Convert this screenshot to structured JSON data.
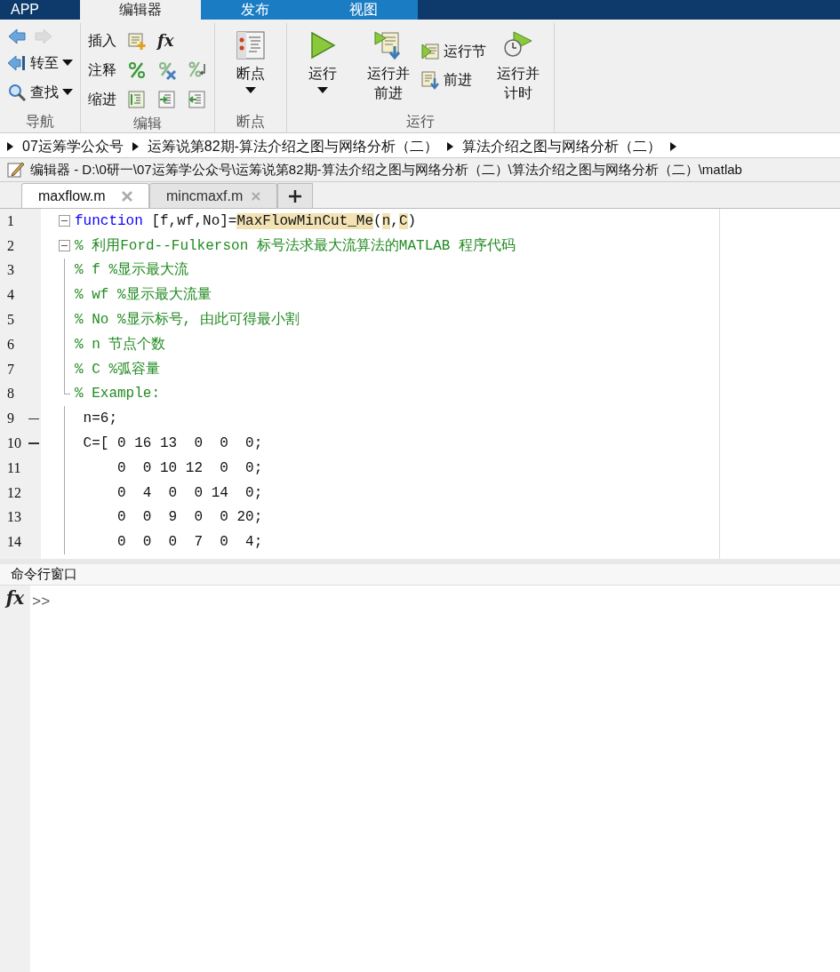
{
  "ribbon_tabs": [
    {
      "label": "APP",
      "selected": false
    },
    {
      "label": "编辑器",
      "selected": true
    },
    {
      "label": "发布",
      "selected": false
    },
    {
      "label": "视图",
      "selected": false
    }
  ],
  "ribbon_groups": [
    {
      "title": "导航",
      "kind": "nav",
      "items": [
        {
          "disabled": false
        },
        {
          "disabled": true
        },
        {
          "label": "转至"
        },
        {
          "label": "查找"
        }
      ]
    },
    {
      "title": "编辑",
      "kind": "edit",
      "items": [
        {
          "label": "插入",
          "function_button": "fx"
        },
        {
          "label": "注释"
        },
        {
          "label": "缩进"
        }
      ]
    },
    {
      "title": "断点",
      "kind": "big",
      "items": [
        {
          "label": "断点",
          "dropdown": true
        }
      ]
    },
    {
      "title": "运行",
      "kind": "run",
      "items": [
        {
          "label": "运行",
          "dropdown": true,
          "kind": "large"
        },
        {
          "label": "运行并前进",
          "dropdown": false,
          "kind": "large"
        },
        {
          "label": "运行节",
          "kind": "small"
        },
        {
          "label": "前进",
          "kind": "small"
        },
        {
          "label": "运行并计时",
          "dropdown": false,
          "kind": "large"
        }
      ]
    }
  ],
  "breadcrumb": [
    "07运筹学公众号",
    "运筹说第82期-算法介绍之图与网络分析（二）",
    "算法介绍之图与网络分析（二）"
  ],
  "editor_title": "编辑器 - D:\\0研一\\07运筹学公众号\\运筹说第82期-算法介绍之图与网络分析（二）\\算法介绍之图与网络分析（二）\\matlab",
  "file_tabs": [
    {
      "label": "maxflow.m",
      "selected": true
    },
    {
      "label": "mincmaxf.m",
      "selected": false
    }
  ],
  "code_lines": [
    {
      "number": "1",
      "fold_start": true,
      "fold_end": false,
      "executable": false,
      "segments": [
        {
          "text": "function",
          "kind": "keyword",
          "highlighted": false
        },
        {
          "text": " [f,wf,No]=",
          "kind": "plain",
          "highlighted": false
        },
        {
          "text": "MaxFlowMinCut_Me",
          "kind": "plain",
          "highlighted": true
        },
        {
          "text": "(",
          "kind": "plain",
          "highlighted": false
        },
        {
          "text": "n",
          "kind": "plain",
          "highlighted": true
        },
        {
          "text": ",",
          "kind": "plain",
          "highlighted": false
        },
        {
          "text": "C",
          "kind": "plain",
          "highlighted": true
        },
        {
          "text": ")",
          "kind": "plain",
          "highlighted": false
        }
      ]
    },
    {
      "number": "2",
      "fold_start": true,
      "fold_end": false,
      "executable": false,
      "segments": [
        {
          "text": "% 利用Ford--Fulkerson 标号法求最大流算法的MATLAB 程序代码",
          "kind": "comment",
          "highlighted": false
        }
      ]
    },
    {
      "number": "3",
      "fold_start": false,
      "fold_end": false,
      "executable": false,
      "segments": [
        {
          "text": "% f %显示最大流",
          "kind": "comment",
          "highlighted": false
        }
      ]
    },
    {
      "number": "4",
      "fold_start": false,
      "fold_end": false,
      "executable": false,
      "segments": [
        {
          "text": "% wf %显示最大流量",
          "kind": "comment",
          "highlighted": false
        }
      ]
    },
    {
      "number": "5",
      "fold_start": false,
      "fold_end": false,
      "executable": false,
      "segments": [
        {
          "text": "% No %显示标号, 由此可得最小割",
          "kind": "comment",
          "highlighted": false
        }
      ]
    },
    {
      "number": "6",
      "fold_start": false,
      "fold_end": false,
      "executable": false,
      "segments": [
        {
          "text": "% n 节点个数",
          "kind": "comment",
          "highlighted": false
        }
      ]
    },
    {
      "number": "7",
      "fold_start": false,
      "fold_end": false,
      "executable": false,
      "segments": [
        {
          "text": "% C %弧容量",
          "kind": "comment",
          "highlighted": false
        }
      ]
    },
    {
      "number": "8",
      "fold_start": false,
      "fold_end": true,
      "executable": false,
      "segments": [
        {
          "text": "% Example:",
          "kind": "comment",
          "highlighted": false
        }
      ]
    },
    {
      "number": "9",
      "fold_start": false,
      "fold_end": false,
      "executable": true,
      "segments": [
        {
          "text": " n=6;",
          "kind": "plain",
          "highlighted": false
        }
      ]
    },
    {
      "number": "10",
      "fold_start": false,
      "fold_end": false,
      "executable": true,
      "segments": [
        {
          "text": " C=[ 0 16 13  0  0  0;",
          "kind": "plain",
          "highlighted": false
        }
      ]
    },
    {
      "number": "11",
      "fold_start": false,
      "fold_end": false,
      "executable": false,
      "segments": [
        {
          "text": "     0  0 10 12  0  0;",
          "kind": "plain",
          "highlighted": false
        }
      ]
    },
    {
      "number": "12",
      "fold_start": false,
      "fold_end": false,
      "executable": false,
      "segments": [
        {
          "text": "     0  4  0  0 14  0;",
          "kind": "plain",
          "highlighted": false
        }
      ]
    },
    {
      "number": "13",
      "fold_start": false,
      "fold_end": false,
      "executable": false,
      "segments": [
        {
          "text": "     0  0  9  0  0 20;",
          "kind": "plain",
          "highlighted": false
        }
      ]
    },
    {
      "number": "14",
      "fold_start": false,
      "fold_end": false,
      "executable": false,
      "segments": [
        {
          "text": "     0  0  0  7  0  4;",
          "kind": "plain",
          "highlighted": false
        }
      ]
    }
  ],
  "command_window": {
    "title": "命令行窗口",
    "function_button": "fx",
    "prompt": ">>"
  }
}
